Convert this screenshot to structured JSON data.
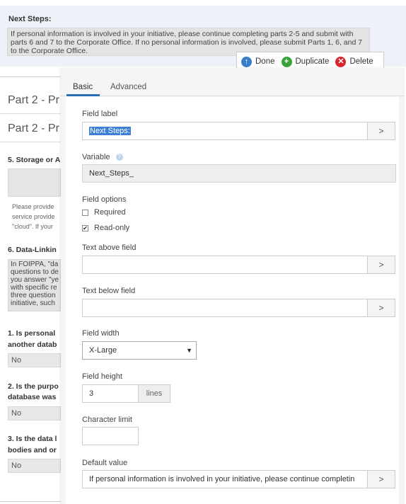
{
  "background": {
    "next_steps_title": "Next Steps:",
    "next_steps_text": "If personal information is involved in your initiative, please continue completing parts 2-5 and submit with parts 6 and 7 to the Corporate Office. If no personal information is involved, please submit Parts 1, 6, and 7 to the Corporate Office.",
    "part_heading_1": "Part 2 - Pr",
    "part_heading_2": "Part 2 - Pr",
    "q5": "5. Storage or A",
    "q5_help_1": "Please provide",
    "q5_help_2": "service provide",
    "q5_help_3": "\"cloud\". If your",
    "q6": "6. Data-Linkin",
    "q6_text_1": "In FOIPPA, \"da",
    "q6_text_2": "questions to de",
    "q6_text_3": "you answer \"ye",
    "q6_text_4": "with specific re",
    "q6_text_5": "three question",
    "q6_text_6": "initiative, such",
    "q1_line1": "1. Is personal",
    "q1_line2": "another datab",
    "q1_answer": "No",
    "q2_line1": "2. Is the purpo",
    "q2_line2": "database was",
    "q2_answer": "No",
    "q3_line1": "3. Is the data l",
    "q3_line2": "bodies and or",
    "q3_answer": "No"
  },
  "toolbar": {
    "done_label": "Done",
    "duplicate_label": "Duplicate",
    "delete_label": "Delete"
  },
  "tabs": {
    "basic": "Basic",
    "advanced": "Advanced"
  },
  "form": {
    "field_label_label": "Field label",
    "field_label_value": "Next Steps:",
    "variable_label": "Variable",
    "variable_value": "Next_Steps_",
    "field_options_label": "Field options",
    "required_label": "Required",
    "required_checked": false,
    "readonly_label": "Read-only",
    "readonly_checked": true,
    "text_above_label": "Text above field",
    "text_above_value": "",
    "text_below_label": "Text below field",
    "text_below_value": "",
    "field_width_label": "Field width",
    "field_width_value": "X-Large",
    "field_height_label": "Field height",
    "field_height_value": "3",
    "field_height_unit": "lines",
    "char_limit_label": "Character limit",
    "char_limit_value": "",
    "default_value_label": "Default value",
    "default_value_value": "If personal information is involved in your initiative, please continue completin"
  },
  "icons": {
    "expand": ">",
    "help": "?",
    "check": "✔",
    "dropdown": "▼"
  },
  "colors": {
    "accent": "#2b6fb6",
    "done": "#3a7dc9",
    "duplicate": "#3aa23a",
    "delete": "#d9262d"
  }
}
